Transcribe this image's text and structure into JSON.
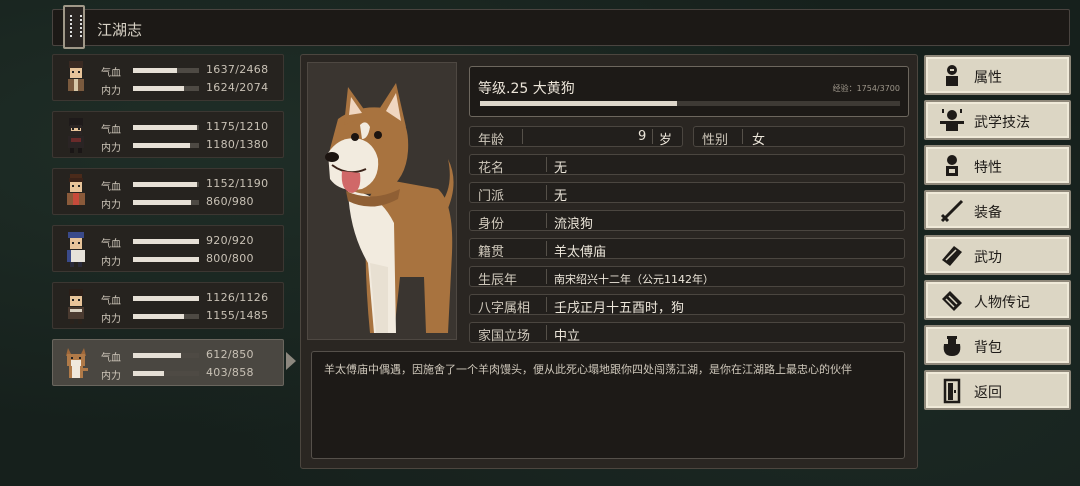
{
  "header": {
    "title": "江湖志"
  },
  "party": [
    {
      "hp_label": "气血",
      "mp_label": "内力",
      "hp": "1637/2468",
      "mp": "1624/2074",
      "hp_frac": 0.66,
      "mp_frac": 0.78
    },
    {
      "hp_label": "气血",
      "mp_label": "内力",
      "hp": "1175/1210",
      "mp": "1180/1380",
      "hp_frac": 0.97,
      "mp_frac": 0.86
    },
    {
      "hp_label": "气血",
      "mp_label": "内力",
      "hp": "1152/1190",
      "mp": "860/980",
      "hp_frac": 0.97,
      "mp_frac": 0.88
    },
    {
      "hp_label": "气血",
      "mp_label": "内力",
      "hp": "920/920",
      "mp": "800/800",
      "hp_frac": 1.0,
      "mp_frac": 1.0
    },
    {
      "hp_label": "气血",
      "mp_label": "内力",
      "hp": "1126/1126",
      "mp": "1155/1485",
      "hp_frac": 1.0,
      "mp_frac": 0.78
    },
    {
      "hp_label": "气血",
      "mp_label": "内力",
      "hp": "612/850",
      "mp": "403/858",
      "hp_frac": 0.72,
      "mp_frac": 0.47
    }
  ],
  "character": {
    "level_text": "等级.25 大黄狗",
    "exp_text": "经验：1754/3700",
    "exp_frac": 0.47,
    "age_label": "年龄",
    "age_value": "9",
    "age_unit": "岁",
    "gender_label": "性别",
    "gender_value": "女",
    "fields": [
      {
        "key": "花名",
        "value": "无"
      },
      {
        "key": "门派",
        "value": "无"
      },
      {
        "key": "身份",
        "value": "流浪狗"
      },
      {
        "key": "籍贯",
        "value": "羊太傅庙"
      },
      {
        "key": "生辰年",
        "value": "南宋绍兴十二年（公元1142年）"
      },
      {
        "key": "八字属相",
        "value": "壬戌正月十五酉时，狗"
      },
      {
        "key": "家国立场",
        "value": "中立"
      }
    ],
    "description": "羊太傅庙中偶遇，因施舍了一个羊肉馒头，便从此死心塌地跟你四处闯荡江湖，是你在江湖路上最忠心的伙伴"
  },
  "menu": [
    {
      "label": "属性",
      "icon": "person-icon"
    },
    {
      "label": "武学技法",
      "icon": "martial-skill-icon"
    },
    {
      "label": "特性",
      "icon": "trait-icon"
    },
    {
      "label": "装备",
      "icon": "sword-icon"
    },
    {
      "label": "武功",
      "icon": "book-icon"
    },
    {
      "label": "人物传记",
      "icon": "biography-icon"
    },
    {
      "label": "背包",
      "icon": "bag-icon"
    },
    {
      "label": "返回",
      "icon": "door-icon"
    }
  ]
}
